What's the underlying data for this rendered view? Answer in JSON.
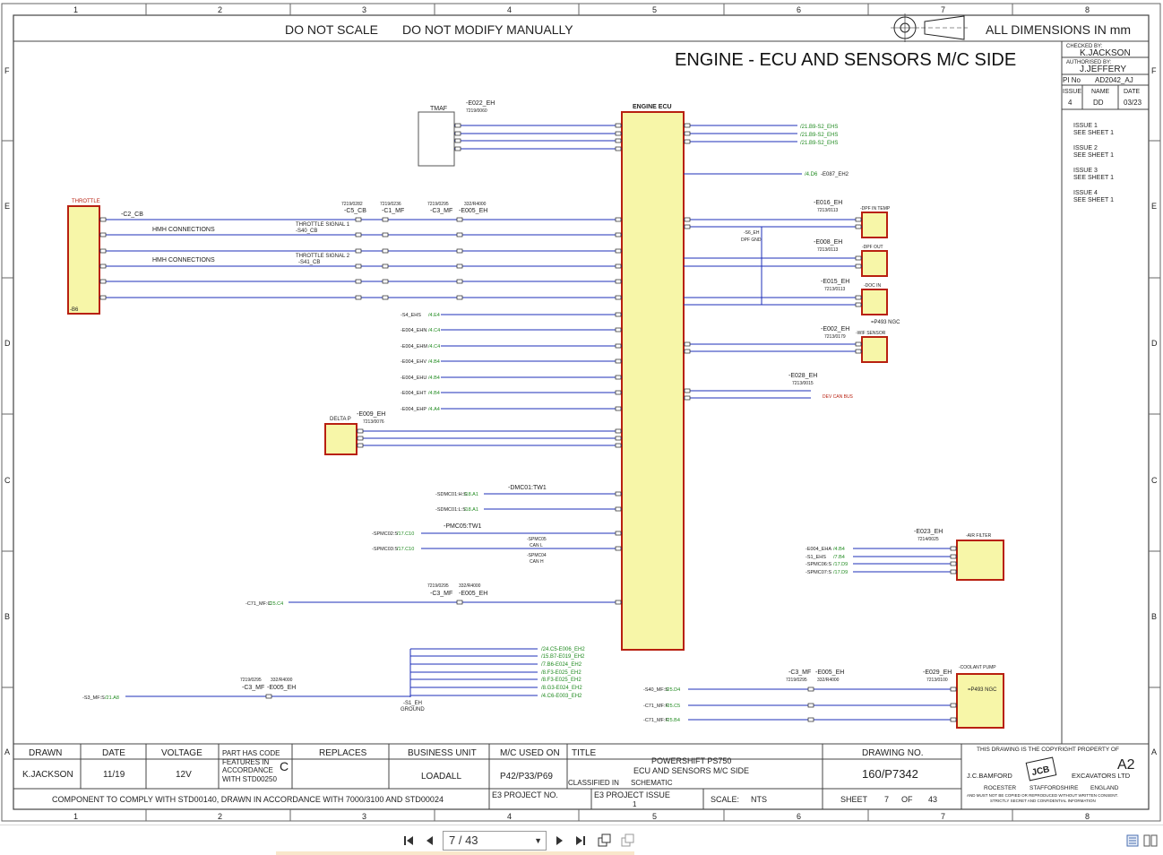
{
  "sheet": {
    "grid_columns": [
      "1",
      "2",
      "3",
      "4",
      "5",
      "6",
      "7",
      "8"
    ],
    "grid_rows": [
      "F",
      "E",
      "D",
      "C",
      "B",
      "A"
    ],
    "header_notes": [
      "DO NOT SCALE",
      "DO NOT MODIFY MANUALLY"
    ],
    "dimensions_note": "ALL DIMENSIONS IN mm",
    "title": "ENGINE - ECU AND SENSORS M/C SIDE"
  },
  "approval": {
    "checked_label": "CHECKED BY:",
    "checked_by": "K.JACKSON",
    "authorised_label": "AUTHORISED BY:",
    "authorised_by": "J.JEFFERY",
    "pi_label": "PI No",
    "pi_no": "AD2042_AJ",
    "issue_header": "ISSUE",
    "name_header": "NAME",
    "date_header": "DATE",
    "issue": "4",
    "name": "DD",
    "date": "03/23"
  },
  "issues": [
    {
      "line1": "ISSUE 1",
      "line2": "SEE SHEET 1"
    },
    {
      "line1": "ISSUE 2",
      "line2": "SEE SHEET 1"
    },
    {
      "line1": "ISSUE 3",
      "line2": "SEE SHEET 1"
    },
    {
      "line1": "ISSUE 4",
      "line2": "SEE SHEET 1"
    }
  ],
  "components": {
    "ecu": "ENGINE ECU",
    "ecu_ref": "-E022_EH",
    "ecu_part": "7219/0060",
    "tmaf": "TMAF",
    "throttle": "THROTTLE",
    "throttle_ref": "-C2_CB",
    "throttle_pin": "-B6",
    "hmh1": "HMH CONNECTIONS",
    "hmh2": "HMH CONNECTIONS",
    "ts1": "THROTTLE SIGNAL 1",
    "ts1_ref": "-S40_CB",
    "ts2": "THROTTLE SIGNAL 2",
    "ts2_ref": "-S41_CB",
    "c5": "-C5_CB",
    "c5_part": "7219/0282",
    "c1": "-C1_MF",
    "c1_part": "7219/0236",
    "c3": "-C3_MF",
    "c3_part": "7219/0295",
    "e005": "-E005_EH",
    "e005_part": "332/R4000",
    "delta_p": "DELTA P",
    "delta_p_ref": "-E009_EH",
    "delta_p_part": "7213/0076",
    "dpf_temp": "-DPF IN TEMP",
    "dpf_temp_ref": "-E016_EH",
    "dpf_temp_part": "7213/0113",
    "dpf_out": "-DPF OUT",
    "dpf_out_ref": "-E008_EH",
    "dpf_out_part": "7213/0113",
    "doc_in": "-DOC IN",
    "doc_in_ref": "-E015_EH",
    "doc_in_part": "7213/0113",
    "p493": "=P493 NGC",
    "wif": "-WIF SENSOR",
    "wif_ref": "-E002_EH",
    "wif_part": "7213/0179",
    "e028": "-E028_EH",
    "e028_part": "7213/0015",
    "dev_can": "DEV CAN BUS",
    "grid_ref": "-E087_EH2",
    "s6": "-S6_EH",
    "dpf_gnd": "DPF GND",
    "s1": "-S1_EH",
    "ground": "GROUND",
    "air_filter": "-AIR FILTER",
    "air_filter_ref": "-E023_EH",
    "air_filter_part": "7214/0025",
    "coolant": "-COOLANT PUMP",
    "coolant_ref": "-E029_EH",
    "coolant_part": "7213/0100",
    "coolant_p493": "=P493 NGC",
    "dmc01": "-DMC01:TW1",
    "pmc05": "-PMC05:TW1",
    "spmc05": "-SPMC05",
    "spmc04": "-SPMC04",
    "can_l": "CAN L",
    "can_h": "CAN H"
  },
  "inputs_left": [
    {
      "name": "-S4_EHS",
      "ref": "/4.E4"
    },
    {
      "name": "-E004_EHN",
      "ref": "/4.C4"
    },
    {
      "name": "-E004_EHM",
      "ref": "/4.C4"
    },
    {
      "name": "-E004_EHV",
      "ref": "/4.B4"
    },
    {
      "name": "-E004_EHU",
      "ref": "/4.B4"
    },
    {
      "name": "-E004_EHT",
      "ref": "/4.B4"
    },
    {
      "name": "-E004_EHP",
      "ref": "/4.A4"
    }
  ],
  "dmc_inputs": [
    {
      "name": "-SDMC01:H:S",
      "ref": "/18.A1"
    },
    {
      "name": "-SDMC01:L:S",
      "ref": "/18.A1"
    }
  ],
  "pmc_inputs": [
    {
      "name": "-SPMC02:S",
      "ref": "/17.C10"
    },
    {
      "name": "-SPMC03:S",
      "ref": "/17.C10"
    }
  ],
  "ecu_ground_refs": [
    "/21.B9-S2_EHS",
    "/21.B9-S2_EHS",
    "/21.B9-S2_EHS"
  ],
  "grid_heater_ref": "/4.D6",
  "c71_input": {
    "name": "-C71_MF:C",
    "ref": "/25.C4"
  },
  "s3_input": {
    "name": "-S3_MF:S",
    "ref": "/21.A8"
  },
  "ground_refs": [
    "/24.C5-E006_EH2",
    "/15.B7-E019_EH2",
    "/7.B6-E024_EH2",
    "/8.F3-E025_EH2",
    "/8.F3-E025_EH2",
    "/8.G3-E024_EH2",
    "/4.C6-E003_EH2"
  ],
  "air_filter_inputs": [
    {
      "name": "-E004_EHA",
      "ref": "/4.B4"
    },
    {
      "name": "-S1_EHS",
      "ref": "/7.B4"
    },
    {
      "name": "-SPMC06:S",
      "ref": "/17.D9"
    },
    {
      "name": "-SPMC07:S",
      "ref": "/17.D9"
    }
  ],
  "coolant_inputs": [
    {
      "name": "-S40_MF:S",
      "ref": "/25.D4"
    },
    {
      "name": "-C71_MF:F",
      "ref": "/25.C5"
    },
    {
      "name": "-C71_MF:F",
      "ref": "/25.B4"
    }
  ],
  "title_block": {
    "drawn_h": "DRAWN",
    "date_h": "DATE",
    "voltage_h": "VOLTAGE",
    "partcode_lines": [
      "PART HAS CODE",
      "FEATURES IN",
      "ACCORDANCE",
      "WITH STD00250"
    ],
    "partcode_letter": "C",
    "replaces_h": "REPLACES",
    "business_h": "BUSINESS UNIT",
    "mc_h": "M/C USED ON",
    "title_h": "TITLE",
    "drawn": "K.JACKSON",
    "date": "11/19",
    "voltage": "12V",
    "business": "LOADALL",
    "mc": "P42/P33/P69",
    "title_lines": [
      "POWERSHIFT PS750",
      "ECU AND SENSORS M/C SIDE"
    ],
    "classified_label": "CLASSIFIED IN",
    "classified": "SCHEMATIC",
    "drawing_no_h": "DRAWING NO.",
    "drawing_no": "160/P7342",
    "comply": "COMPONENT TO COMPLY WITH STD00140, DRAWN IN ACCORDANCE WITH 7000/3100 AND STD00024",
    "e3_project": "E3 PROJECT NO.",
    "e3_issue": "E3 PROJECT ISSUE",
    "e3_issue_val": "1",
    "scale_label": "SCALE:",
    "scale": "NTS",
    "sheet_label": "SHEET",
    "sheet": "7",
    "of_label": "OF",
    "sheets": "43",
    "copyright": "THIS DRAWING IS THE COPYRIGHT PROPERTY OF",
    "size": "A2",
    "company_left": "J.C.BAMFORD",
    "company_right": "EXCAVATORS LTD",
    "town": "ROCESTER",
    "county": "STAFFORDSHIRE",
    "country": "ENGLAND",
    "logo": "JCB",
    "notice1": "AND MUST NOT BE COPIED OR REPRODUCED WITHOUT WRITTEN CONSENT.",
    "notice2": "STRICTLY SECRET AND CONFIDENTIAL INFORMATION"
  },
  "toolbar": {
    "page_value": "7 / 43"
  },
  "icons": {
    "first": "first-page-icon",
    "prev": "prev-page-icon",
    "next": "next-page-icon",
    "last": "last-page-icon",
    "rotate": "rotate-icon",
    "fit": "fit-page-icon",
    "view": "view-mode-icon"
  },
  "colors": {
    "wire_blue": "#1e2fb8",
    "ref_green": "#1f8a1f",
    "component_red": "#b82010",
    "ecu_fill": "#f7f6a8",
    "frame": "#555555"
  }
}
